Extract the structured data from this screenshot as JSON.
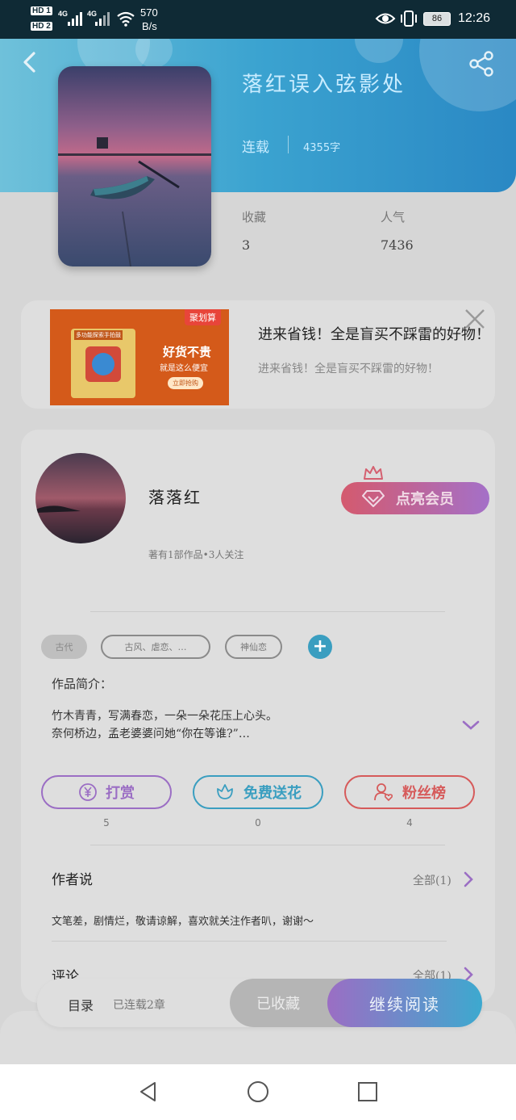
{
  "status_bar": {
    "sim1": "HD 1",
    "sim2": "HD 2",
    "net1": "4G",
    "net2": "4G",
    "speed_value": "570",
    "speed_unit": "B/s",
    "battery": "86",
    "time": "12:26"
  },
  "book": {
    "title": "落红误入弦影处",
    "status": "连载",
    "word_count": "4355字",
    "stats": [
      {
        "label": "收藏",
        "value": "3"
      },
      {
        "label": "人气",
        "value": "7436"
      }
    ]
  },
  "ad": {
    "title": "进来省钱！全是盲买不踩雷的好物！",
    "subtitle": "进来省钱！全是盲买不踩雷的好物！",
    "badge": "聚划算",
    "product_caption": "多功能探索手拍鼓",
    "slogan": "好货不贵",
    "slogan_sub": "就是这么便宜",
    "cta": "立即抢购"
  },
  "author": {
    "name": "落落红",
    "meta": "著有1部作品•3人关注",
    "vip_button": "点亮会员"
  },
  "tags": [
    "古代",
    "古风、虐恋、…",
    "神仙恋"
  ],
  "intro": {
    "label": "作品简介：",
    "line1": "竹木青青，写满春恋，一朵一朵花压上心头。",
    "line2": "奈何桥边，孟老婆婆问她“你在等谁?”…"
  },
  "actions": [
    {
      "label": "打赏",
      "count": "5",
      "color": "#9b6ec4"
    },
    {
      "label": "免费送花",
      "count": "0",
      "color": "#3a9ec0"
    },
    {
      "label": "粉丝榜",
      "count": "4",
      "color": "#d65a5a"
    }
  ],
  "author_says": {
    "title": "作者说",
    "all_label": "全部(1)",
    "text": "文笔差，剧情烂，敬请谅解，喜欢就关注作者叭，谢谢～"
  },
  "comments": {
    "title": "评论",
    "all_label": "全部(1)"
  },
  "bottom_bar": {
    "toc_label": "目录",
    "toc_status": "已连载2章",
    "collected_label": "已收藏",
    "continue_label": "继续阅读"
  },
  "colors": {
    "header_gradient_start": "#6fc1da",
    "header_gradient_end": "#2a88c4",
    "accent_purple": "#9b6ec4",
    "accent_blue": "#3a9ec0",
    "accent_red": "#d65a5a"
  }
}
